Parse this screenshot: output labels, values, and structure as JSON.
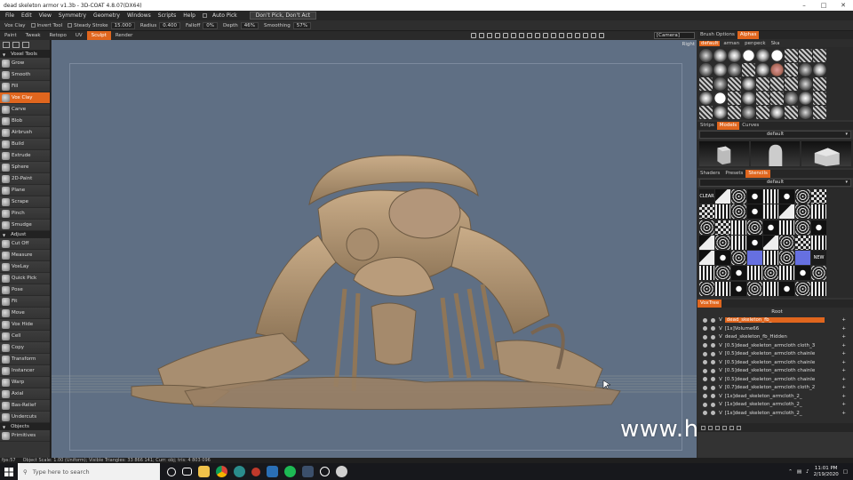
{
  "window": {
    "title": "dead skeleton armor v1.3b - 3D-COAT 4.8.07(DX64)",
    "min_icon": "minimize-icon",
    "max_icon": "maximize-icon",
    "close_icon": "close-icon"
  },
  "menu": {
    "items": [
      "File",
      "Edit",
      "View",
      "Symmetry",
      "Geometry",
      "Windows",
      "Scripts",
      "Help",
      "Auto Pick"
    ],
    "pick_dropdown": "Don't Pick, Don't Act"
  },
  "tool_options": {
    "tool": "Vox Clay",
    "invert": "Invert Tool",
    "steady": "Steady Stroke",
    "steady_value": "15.000",
    "radius": "Radius",
    "radius_value": "0.400",
    "falloff": "Falloff",
    "falloff_value": "0%",
    "depth": "Depth",
    "depth_value": "46%",
    "smoothing": "Smoothing",
    "smoothing_value": "57%"
  },
  "rooms": [
    "Paint",
    "Tweak",
    "Retopo",
    "UV",
    "Sculpt",
    "Render"
  ],
  "active_room": "Sculpt",
  "camera": "[Camera]",
  "viewport": {
    "label": "Right"
  },
  "left_panel": {
    "voxel_header": "Voxel Tools",
    "voxel_tools": [
      "Grow",
      "Smooth",
      "Fill",
      "Vox Clay",
      "Carve",
      "Blob",
      "Airbrush",
      "Build",
      "Extrude",
      "Sphere",
      "2D-Paint",
      "Plane",
      "Scrape",
      "Pinch",
      "Smudge"
    ],
    "active_tool": "Vox Clay",
    "adjust_header": "Adjust",
    "adjust_tools": [
      "Cut Off",
      "Measure",
      "VoxLay",
      "Quick Pick",
      "Pose",
      "Fit",
      "Move",
      "Vox Hide",
      "Cell",
      "Copy",
      "Transform",
      "Instancer",
      "Warp",
      "Axial",
      "Bas-Relief",
      "Undercuts"
    ],
    "objects_header": "Objects",
    "objects_tools": [
      "Primitives"
    ]
  },
  "right_panel": {
    "top_tabs": [
      "Brush Options",
      "Alphas"
    ],
    "active_top_tab": "Alphas",
    "alpha_presets": [
      "default",
      "arman",
      "penpeck",
      "Ska"
    ],
    "mid_tabs": [
      "Strips",
      "Models",
      "Curves"
    ],
    "active_mid_tab": "Models",
    "models_dropdown": "default",
    "stencil_tabs": [
      "Shaders",
      "Presets",
      "Stencils"
    ],
    "active_stencil_tab": "Stencils",
    "stencils_dropdown": "default",
    "stencil_first_label": "CLEAR",
    "stencil_last_label": "NEW",
    "voxtree_tab": "VoxTree",
    "tree_root": "Root",
    "tree_rows": [
      {
        "prefix": "V",
        "name": "dead_skeleton_fb_",
        "selected": true
      },
      {
        "prefix": "V",
        "name": "[1x]Volume66",
        "selected": false
      },
      {
        "prefix": "V",
        "name": "dead_skeleton_fb_Hidden",
        "selected": false
      },
      {
        "prefix": "V",
        "name": "[0.5]dead_skeleton_armcloth cloth_3",
        "selected": false
      },
      {
        "prefix": "V",
        "name": "[0.5]dead_skeleton_armcloth chainle",
        "selected": false
      },
      {
        "prefix": "V",
        "name": "[0.5]dead_skeleton_armcloth chainle",
        "selected": false
      },
      {
        "prefix": "V",
        "name": "[0.5]dead_skeleton_armcloth chainle",
        "selected": false
      },
      {
        "prefix": "V",
        "name": "[0.5]dead_skeleton_armcloth chainle",
        "selected": false
      },
      {
        "prefix": "V",
        "name": "[0.7]dead_skeleton_armcloth cloth_2",
        "selected": false
      },
      {
        "prefix": "V",
        "name": "[1x]dead_skeleton_armcloth_2_",
        "selected": false
      },
      {
        "prefix": "V",
        "name": "[1x]dead_skeleton_armcloth_2_",
        "selected": false
      },
      {
        "prefix": "V",
        "name": "[1x]dead_skeleton_armcloth_2_",
        "selected": false
      }
    ]
  },
  "statusbar": {
    "fps": "fps:57",
    "info": "Object Scale: 1.00 (Uniform); Visible Triangles: 33 866 141; Curr: obj; tris: 4 803 096"
  },
  "watermark": "www.hunls.com",
  "taskbar": {
    "search_placeholder": "Type here to search",
    "time": "11:01 PM",
    "date": "2/19/2020",
    "icons": [
      "windows-start-icon",
      "search-icon",
      "task-view-icon",
      "file-explorer-icon",
      "chrome-icon",
      "3dcoat-icon",
      "app-icon",
      "store-icon",
      "spotify-icon",
      "steam-icon",
      "app-icon-2",
      "app-icon-3"
    ]
  },
  "colors": {
    "accent": "#e0661e",
    "viewport": "#5f6f84",
    "model": "#b79a79"
  }
}
